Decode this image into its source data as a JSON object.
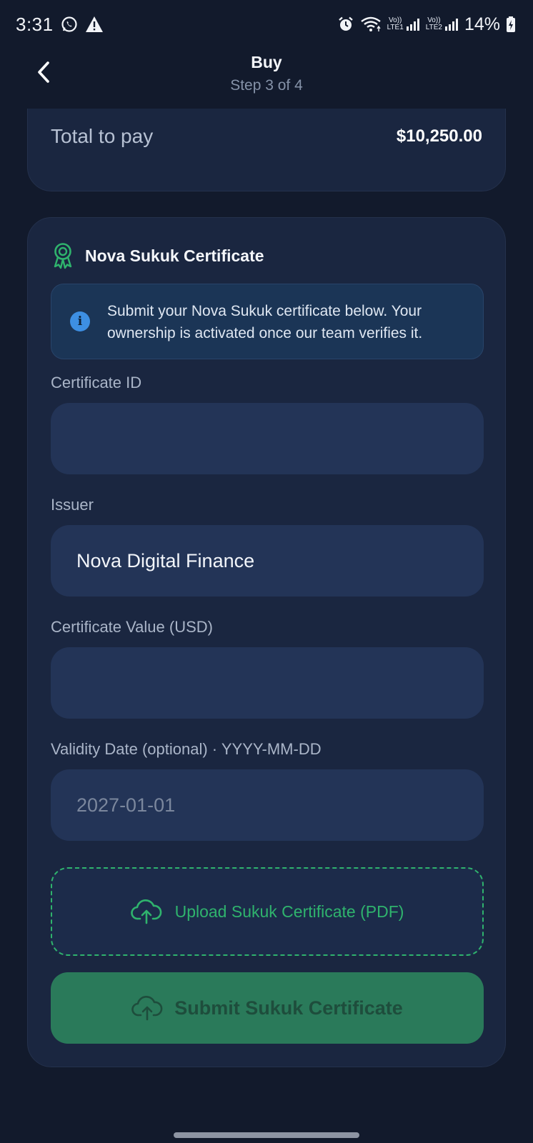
{
  "status_bar": {
    "time": "3:31",
    "battery": "14%",
    "net1_top": "Vo))",
    "net1_bottom": "LTE1",
    "net2_top": "Vo))",
    "net2_bottom": "LTE2"
  },
  "header": {
    "title": "Buy",
    "subtitle": "Step 3 of 4"
  },
  "summary": {
    "total_label": "Total to pay",
    "total_value": "$10,250.00"
  },
  "certificate": {
    "title": "Nova Sukuk Certificate",
    "info_text": "Submit your Nova Sukuk certificate below. Your ownership is activated once our team verifies it.",
    "fields": {
      "certificate_id": {
        "label": "Certificate ID",
        "value": ""
      },
      "issuer": {
        "label": "Issuer",
        "value": "Nova Digital Finance"
      },
      "value_usd": {
        "label": "Certificate Value (USD)",
        "value": ""
      },
      "validity": {
        "label": "Validity Date (optional) · YYYY-MM-DD",
        "placeholder": "2027-01-01",
        "value": ""
      }
    },
    "upload_label": "Upload Sukuk Certificate (PDF)",
    "submit_label": "Submit Sukuk Certificate"
  },
  "colors": {
    "background": "#121a2c",
    "card": "#1a2640",
    "input": "#233457",
    "accent_green": "#2fb36d",
    "submit_disabled": "#2a7a5a",
    "info_blue": "#3d8fe3"
  }
}
